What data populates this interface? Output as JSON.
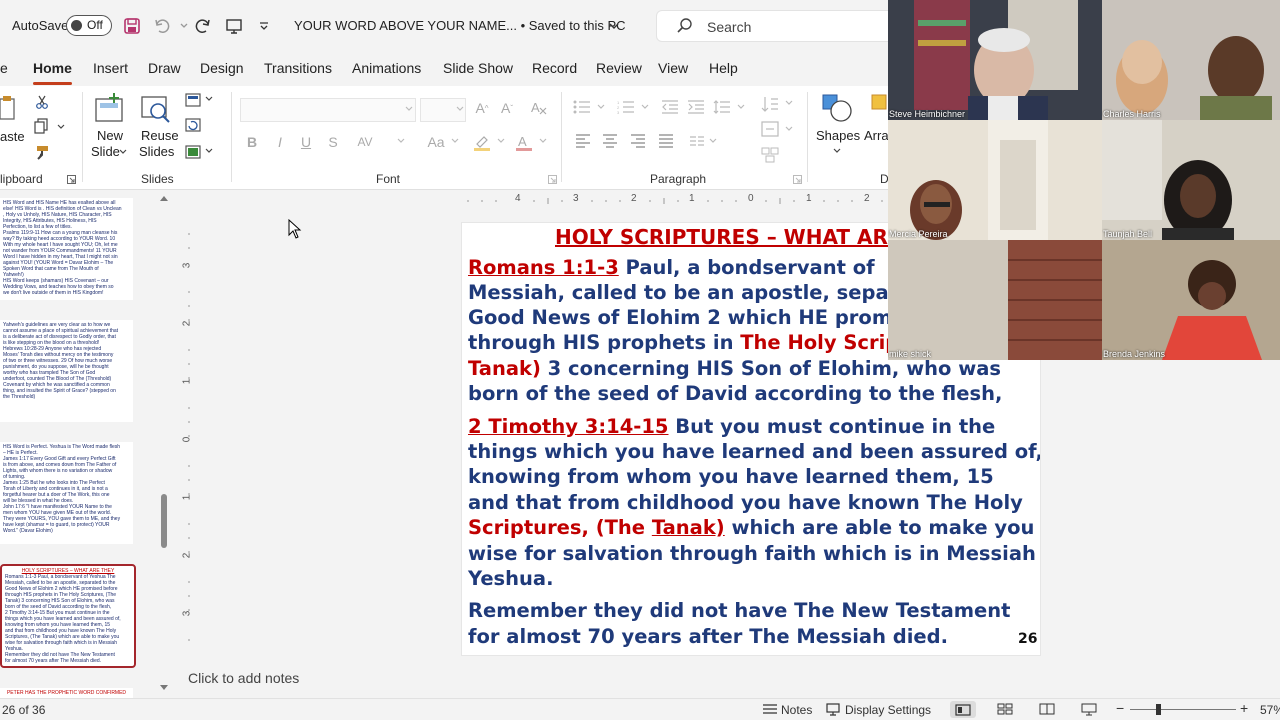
{
  "titlebar": {
    "autosave_label": "AutoSave",
    "autosave_state": "Off",
    "document_title": "YOUR WORD ABOVE YOUR NAME... • Saved to this PC",
    "search_placeholder": "Search"
  },
  "tabs": [
    "e",
    "Home",
    "Insert",
    "Draw",
    "Design",
    "Transitions",
    "Animations",
    "Slide Show",
    "Record",
    "Review",
    "View",
    "Help"
  ],
  "active_tab": "Home",
  "ribbon": {
    "paste_label": "aste",
    "new_slide": [
      "New",
      "Slide"
    ],
    "reuse_slides": [
      "Reuse",
      "Slides"
    ],
    "shapes_label": "Shapes",
    "arrange_label": "Arra",
    "groups": {
      "clipboard": "lipboard",
      "slides": "Slides",
      "font": "Font",
      "paragraph": "Paragraph",
      "drawing": "D"
    }
  },
  "slide": {
    "title": "HOLY SCRIPTURES – WHAT ARE",
    "line1_ref": "Romans 1:1-3",
    "line1_text": "    Paul, a bondservant of",
    "line2": "Messiah, called to be an apostle, separ",
    "line3": "Good News of Elohim 2 which HE prom",
    "line4_a": "through HIS prophets in ",
    "line4_b": "The Holy Scrip",
    "line5_a": "Tanak)",
    "line5_b": " 3 concerning HIS Son of Elohim, who was",
    "line6": "born of the seed of David according to the flesh,",
    "line7_ref": "2 Timothy 3:14-15",
    "line7_text": "   But you must continue in the",
    "line8": "things which you have learned and been assured of,",
    "line9": "knowing from whom you have learned them, 15",
    "line10": "and that from childhood you have known The Holy",
    "line11_a": "Scriptures, (The ",
    "line11_b": "Tanak)",
    "line11_c": " which are able to make you",
    "line12": "wise for salvation through faith which is in Messiah",
    "line13": "Yeshua.",
    "line14": "Remember  they did not have The New Testament",
    "line15": "for almost 70  years after The Messiah died.",
    "page_number": "26"
  },
  "thumbnails": [
    {
      "lines": [
        "HIS Word and HIS Name HE has exalted above all",
        "else! HIS Word is . HIS definition of Clean vs Unclean",
        ", Holy vs Unholy, HIS Nature, HIS Character, HIS",
        "Integrity, HIS Attributes, HIS Holiness, HIS",
        "Perfection, to list a few of titles.",
        "Psalms 119:9-11  How can a young man cleanse his",
        "way? By taking heed according to YOUR Word. 10",
        "With my whole heart I have sought YOU; Oh, let me",
        "not wander from YOUR Commandments! 11 YOUR",
        "Word I have hidden in my heart, That I might not sin",
        "against YOU!  (YOUR Word = Davar Elohim – The",
        "Spoken Word that came from The Mouth of",
        "Yahweh!)",
        "HIS Word keeps (shamars) HIS Covenant – our",
        "Wedding Vows, and teaches how to obey them so",
        "we don't live outside of them in HIS Kingdom!"
      ]
    },
    {
      "lines": [
        "Yahweh's guidelines are very clear as to how we",
        "cannot assume a place of spiritual achievement that",
        "is a deliberate act of disrespect to Godly order, that",
        "is like stepping on the blood on a threshold!",
        "Hebrews 10:28-29  Anyone who has rejected",
        "Moses' Torah dies without mercy on the testimony",
        "of two or three witnesses. 29 Of how much worse",
        "punishment, do you suppose, will he be thought",
        "worthy who has trampled The Son of God",
        "underfoot, counted The Blood of The (Threshold)",
        "Covenant by which he was sanctified a common",
        "thing, and insulted the Spirit of Grace? (stepped on",
        "the Threshold)"
      ]
    },
    {
      "lines": [
        "HIS Word is Perfect.  Yeshua is The Word made flesh",
        "– HE is Perfect.",
        "James 1:17  Every Good Gift and every Perfect Gift",
        "is from above, and comes down from The Father of",
        "Lights, with whom there is no variation or shadow",
        "of turning.",
        "James 1:25  But he who looks into The Perfect",
        "Torah of Liberty and continues in it, and is not a",
        "forgetful hearer but a doer of The Work, this one",
        "will be blessed in what he does.",
        "John 17:6  \"I have manifested YOUR Name to the",
        "men whom YOU have given ME out of the world.",
        "They were YOURS, YOU gave them to ME, and they",
        "have kept (shamar = to guard, to protect) YOUR",
        "Word.\" (Davar Elohim)"
      ]
    },
    {
      "lines": [
        "HOLY SCRIPTURES – WHAT ARE THEY",
        "Romans 1:1-3   Paul, a bondservant of Yeshua The",
        "Messiah, called to be an apostle, separated to the",
        "Good News of Elohim 2 which HE promised before",
        "through HIS prophets in The Holy Scriptures, (The",
        "Tanak) 3 concerning HIS Son of Elohim, who was",
        "born of the seed of David according to the flesh,",
        "2 Timothy 3:14-15   But you must continue in the",
        "things which you have learned and been assured of,",
        "knowing from whom you have learned them, 15",
        "and that from childhood you have known The Holy",
        "Scriptures, (The Tanak) which are able to make you",
        "wise for salvation through faith which is in Messiah",
        "Yeshua.",
        "Remember  they did not have The New Testament",
        "for almost 70  years after The Messiah died."
      ]
    },
    {
      "lines": [
        "PETER HAS THE PROPHETIC WORD CONFIRMED"
      ]
    }
  ],
  "notes_placeholder": "Click to add notes",
  "status": {
    "slide_counter": "26 of 36",
    "notes_label": "Notes",
    "display_settings": "Display Settings",
    "zoom": "57%"
  },
  "participants": [
    "Steve Heimbichner",
    "Charles Harris",
    "Mercia Pereira",
    "Taunjah Bell",
    "mike shick",
    "Brenda Jenkins"
  ],
  "ruler": {
    "h_ticks": [
      "4",
      "3",
      "2",
      "1",
      "0",
      "1",
      "2"
    ],
    "v_ticks": [
      "3",
      "2",
      "1",
      "0",
      "1",
      "2",
      "3"
    ]
  }
}
